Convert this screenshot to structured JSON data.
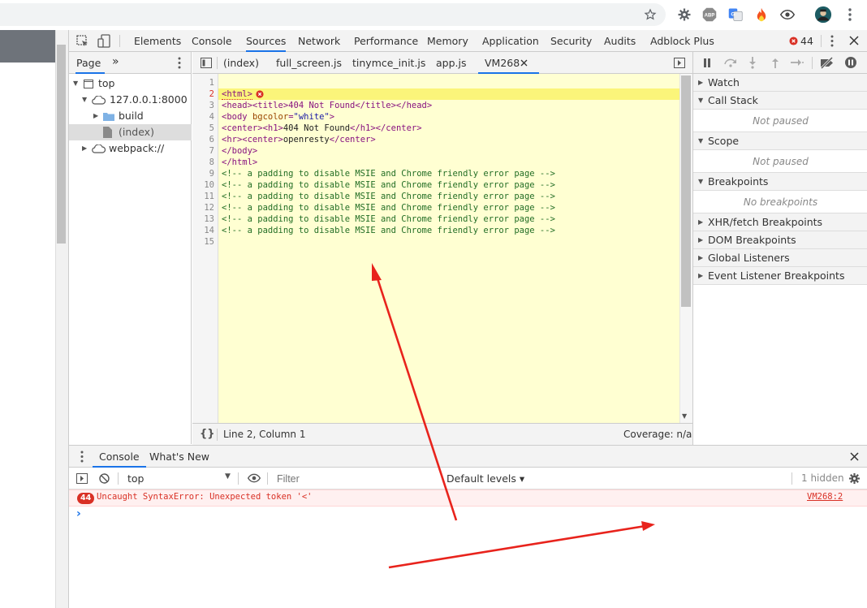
{
  "browser": {
    "icons": [
      "star-icon",
      "settings-extension-icon",
      "abp-icon",
      "translate-icon",
      "fire-extension-icon",
      "eye-extension-icon",
      "avatar",
      "more-vert-icon"
    ],
    "abp_label": "ABP"
  },
  "devtools": {
    "tabs": [
      "Elements",
      "Console",
      "Sources",
      "Network",
      "Performance",
      "Memory",
      "Application",
      "Security",
      "Audits",
      "Adblock Plus"
    ],
    "active_tab": "Sources",
    "error_count": "44"
  },
  "navigator": {
    "tab_label": "Page",
    "more_label": "»",
    "tree": [
      {
        "label": "top"
      },
      {
        "label": "127.0.0.1:8000"
      },
      {
        "label": "build"
      },
      {
        "label": "(index)"
      },
      {
        "label": "webpack://"
      }
    ]
  },
  "editor": {
    "tabs": [
      "(index)",
      "full_screen.js",
      "tinymce_init.js",
      "app.js",
      "VM268"
    ],
    "active_tab": "VM268",
    "line_numbers": [
      "1",
      "2",
      "3",
      "4",
      "5",
      "6",
      "7",
      "8",
      "9",
      "10",
      "11",
      "12",
      "13",
      "14",
      "15"
    ],
    "lines": {
      "l2": "<html>",
      "l3": "<head><title>404 Not Found</title></head>",
      "l4a": "<body ",
      "l4b": "bgcolor",
      "l4c": "=",
      "l4d": "\"white\"",
      "l4e": ">",
      "l5a": "<center><h1>",
      "l5b": "404 Not Found",
      "l5c": "</h1></center>",
      "l6a": "<hr><center>",
      "l6b": "openresty",
      "l6c": "</center>",
      "l7": "</body>",
      "l8": "</html>",
      "comment": "<!-- a padding to disable MSIE and Chrome friendly error page -->"
    },
    "status_position": "Line 2, Column 1",
    "coverage": "Coverage: n/a",
    "format_icon": "{}"
  },
  "debugger": {
    "sections": {
      "watch": "Watch",
      "call_stack": "Call Stack",
      "call_stack_body": "Not paused",
      "scope": "Scope",
      "scope_body": "Not paused",
      "breakpoints": "Breakpoints",
      "breakpoints_body": "No breakpoints",
      "xhr": "XHR/fetch Breakpoints",
      "dom": "DOM Breakpoints",
      "global": "Global Listeners",
      "event": "Event Listener Breakpoints"
    }
  },
  "drawer": {
    "tabs": [
      "Console",
      "What's New"
    ],
    "active_tab": "Console",
    "context": "top",
    "filter_placeholder": "Filter",
    "levels": "Default levels ▾",
    "hidden": "1 hidden",
    "error": {
      "count": "44",
      "message": "Uncaught SyntaxError: Unexpected token '<'",
      "source": "VM268:2"
    },
    "prompt": "›"
  },
  "colors": {
    "accent": "#1a73e8",
    "error": "#d93025",
    "annotation_arrow": "#e8231c"
  }
}
